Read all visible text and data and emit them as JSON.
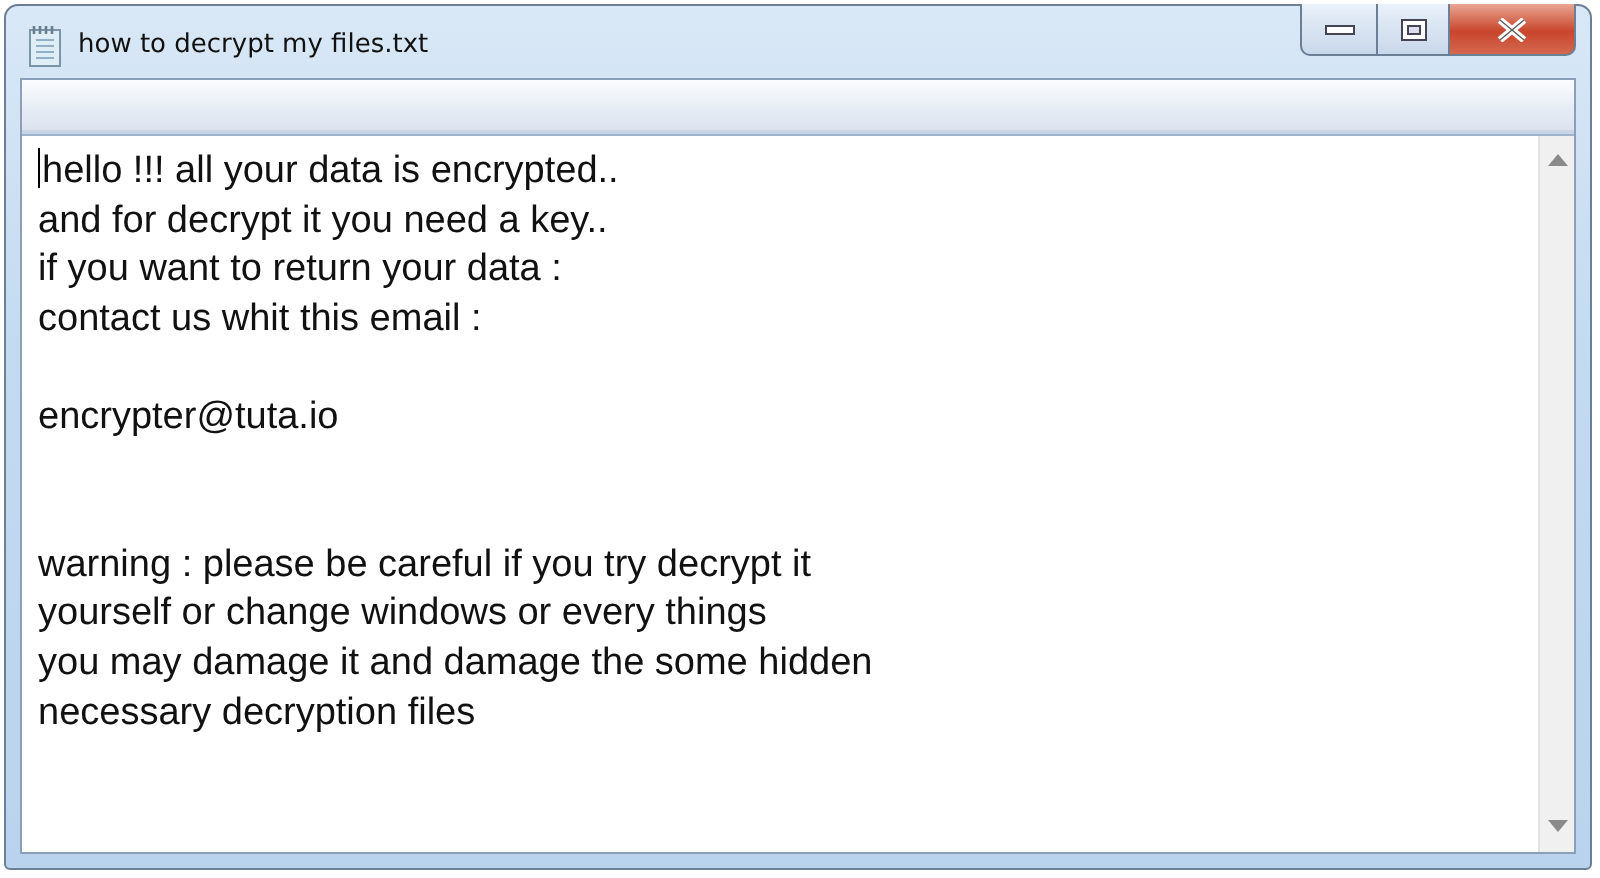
{
  "window": {
    "title": "how to decrypt my files.txt"
  },
  "document": {
    "lines": [
      {
        "kind": "text",
        "text": "hello !!! all your data is encrypted.."
      },
      {
        "kind": "text",
        "text": "and for decrypt it you need a key.."
      },
      {
        "kind": "text",
        "text": "if you want to return your data :"
      },
      {
        "kind": "text",
        "text": "contact us whit this email :"
      },
      {
        "kind": "blank"
      },
      {
        "kind": "text",
        "text": "encrypter@tuta.io"
      },
      {
        "kind": "blank"
      },
      {
        "kind": "blank"
      },
      {
        "kind": "text",
        "text": "warning : please be careful if you try decrypt it"
      },
      {
        "kind": "text",
        "text": "yourself or change windows or every things"
      },
      {
        "kind": "text",
        "text": "you may damage it and damage the some hidden"
      },
      {
        "kind": "text",
        "text": "necessary decryption files"
      }
    ]
  }
}
